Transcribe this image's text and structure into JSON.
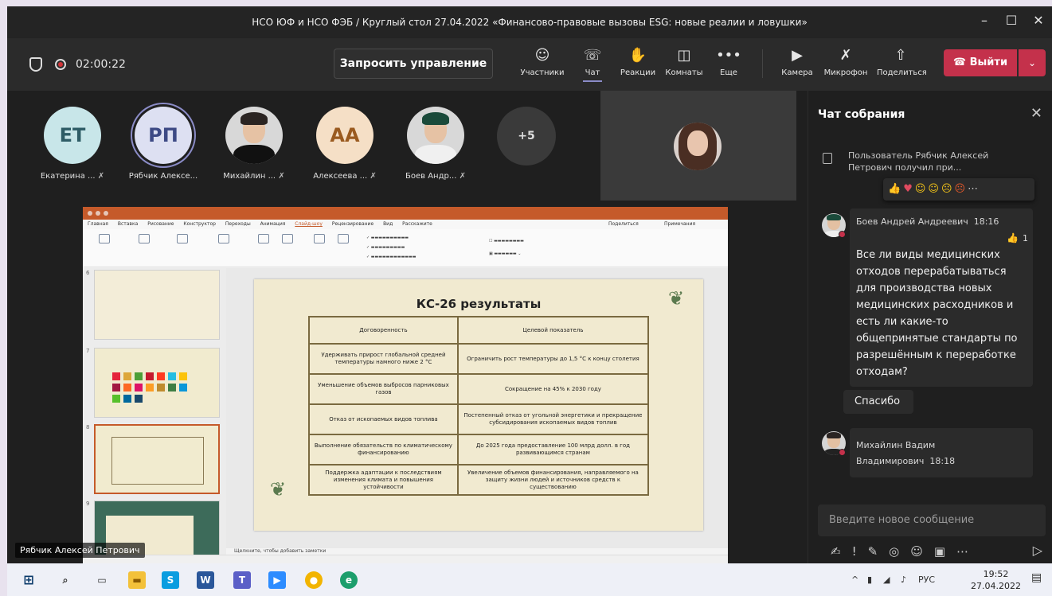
{
  "window": {
    "title": "НСО ЮФ и НСО ФЭБ / Круглый стол 27.04.2022 «Финансово-правовые вызовы ESG: новые реалии и ловушки»"
  },
  "toolbar": {
    "timer": "02:00:22",
    "request_control": "Запросить управление",
    "buttons": {
      "participants": "Участники",
      "chat": "Чат",
      "reactions": "Реакции",
      "rooms": "Комнаты",
      "more": "Еще",
      "camera": "Камера",
      "mic": "Микрофон",
      "share": "Поделиться"
    },
    "leave": "Выйти"
  },
  "participants": [
    {
      "initials": "ЕТ",
      "name": "Екатерина ..."
    },
    {
      "initials": "РП",
      "name": "Рябчик Алексе..."
    },
    {
      "initials": "",
      "name": "Михайлин ..."
    },
    {
      "initials": "АА",
      "name": "Алексеева ..."
    },
    {
      "initials": "",
      "name": "Боев Андр..."
    },
    {
      "initials": "+5",
      "name": ""
    }
  ],
  "presentation": {
    "tabs": [
      "Главная",
      "Вставка",
      "Рисование",
      "Конструктор",
      "Переходы",
      "Анимация",
      "Слайд-шоу",
      "Рецензирование",
      "Вид",
      "Расскажите"
    ],
    "ribbon_share": "Поделиться",
    "ribbon_comments": "Примечания",
    "thumb_numbers": [
      "6",
      "7",
      "8",
      "9"
    ],
    "slide_title": "КС-26 результаты",
    "table": {
      "headers": [
        "Договоренность",
        "Целевой показатель"
      ],
      "rows": [
        [
          "Удерживать прирост глобальной средней температуры намного ниже 2 °С",
          "Ограничить рост температуры до 1,5 °С к концу столетия"
        ],
        [
          "Уменьшение объемов выбросов парниковых газов",
          "Сокращение на 45% к 2030 году"
        ],
        [
          "Отказ от ископаемых видов топлива",
          "Постепенный отказ от угольной энергетики и прекращение субсидирования ископаемых видов топлив"
        ],
        [
          "Выполнение обязательств по климатическому финансированию",
          "До 2025 года предоставление 100 млрд долл. в год развивающимся странам"
        ],
        [
          "Поддержка адаптации к последствиям изменения климата и повышения устойчивости",
          "Увеличение объемов финансирования, направляемого на защиту жизни людей и источников средств к существованию"
        ]
      ]
    },
    "notes_placeholder": "Щелкните, чтобы добавить заметки",
    "presenter_label": "Рябчик Алексей Петрович"
  },
  "chat": {
    "title": "Чат собрания",
    "system_message": "Пользователь Рябчик Алексей Петрович получил при...",
    "messages": [
      {
        "author": "Боев Андрей Андреевич",
        "time": "18:16",
        "text": "Все ли виды медицинских отходов перерабатываться для производства новых медицинских расходников и есть ли какие-то общепринятые стандарты по разрешённым к переработке отходам?",
        "likes": "1"
      },
      {
        "author": "",
        "time": "",
        "text": "Спасибо",
        "likes": ""
      },
      {
        "author": "Михайлин Вадим Владимирович",
        "time": "18:18",
        "text": "",
        "likes": ""
      }
    ],
    "compose_placeholder": "Введите новое сообщение"
  },
  "taskbar": {
    "lang": "РУС",
    "time": "19:52",
    "date": "27.04.2022"
  },
  "colors": {
    "accent": "#8b8cc7",
    "leave": "#c4314b",
    "ppt": "#c55a2a"
  }
}
